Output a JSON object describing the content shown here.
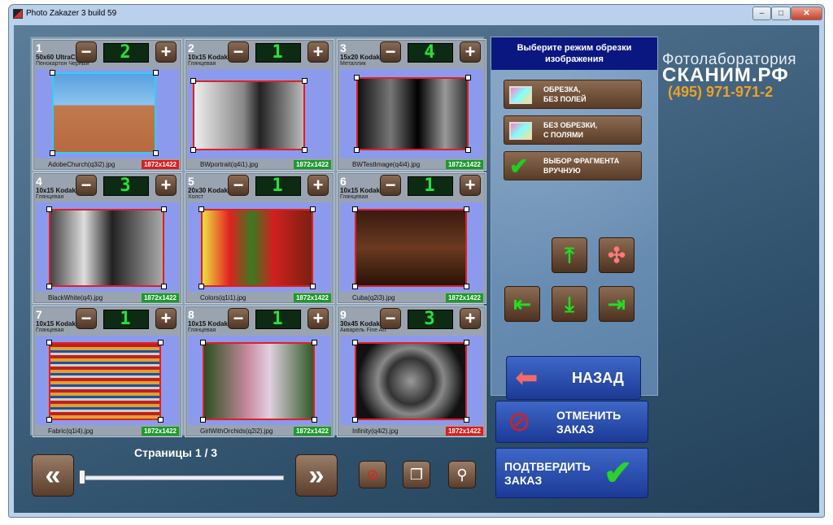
{
  "window": {
    "title": "Photo Zakazer 3 build 59",
    "min": "–",
    "max": "□",
    "close": "✕"
  },
  "photos": [
    {
      "num": "1",
      "size": "50x60 UltraChrome",
      "paper": "Пенокартон Черный",
      "qty": "2",
      "file": "AdobeChurch(q3i2).jpg",
      "res": "1872x1422",
      "res_ok": false
    },
    {
      "num": "2",
      "size": "10x15 Kodak",
      "paper": "Глянцевая",
      "qty": "1",
      "file": "BWportrait(q4i1).jpg",
      "res": "1872x1422",
      "res_ok": true
    },
    {
      "num": "3",
      "size": "15x20 Kodak",
      "paper": "Металлик",
      "qty": "4",
      "file": "BWTestImage(q4i4).jpg",
      "res": "1872x1422",
      "res_ok": true
    },
    {
      "num": "4",
      "size": "10x15 Kodak",
      "paper": "Глянцевая",
      "qty": "3",
      "file": "BlackWhite(q4).jpg",
      "res": "1872x1422",
      "res_ok": true
    },
    {
      "num": "5",
      "size": "20x30 Kodak",
      "paper": "Холст",
      "qty": "1",
      "file": "Colors(q1i1).jpg",
      "res": "1872x1422",
      "res_ok": true
    },
    {
      "num": "6",
      "size": "10x15 Kodak",
      "paper": "Глянцевая",
      "qty": "1",
      "file": "Cuba(q2i3).jpg",
      "res": "1872x1422",
      "res_ok": true
    },
    {
      "num": "7",
      "size": "10x15 Kodak",
      "paper": "Глянцевая",
      "qty": "1",
      "file": "Fabric(q1i4).jpg",
      "res": "1872x1422",
      "res_ok": true
    },
    {
      "num": "8",
      "size": "10x15 Kodak",
      "paper": "Глянцевая",
      "qty": "1",
      "file": "GirlWithOrchids(q2i2).jpg",
      "res": "1872x1422",
      "res_ok": true
    },
    {
      "num": "9",
      "size": "30x45 Kodak",
      "paper": "Акварель Fine Art",
      "qty": "3",
      "file": "Infinity(q4i2).jpg",
      "res": "1872x1422",
      "res_ok": false
    }
  ],
  "stepper": {
    "minus": "−",
    "plus": "+"
  },
  "pager": {
    "label": "Страницы 1 / 3",
    "prev": "«",
    "next": "»"
  },
  "crop": {
    "header": "Выберите режим обрезки изображения",
    "modes": [
      "ОБРЕЗКА,\nБЕЗ ПОЛЕЙ",
      "БЕЗ ОБРЕЗКИ,\nС ПОЛЯМИ",
      "ВЫБОР ФРАГМЕНТА\nВРУЧНУЮ"
    ],
    "back": "НАЗАД"
  },
  "actions": {
    "cancel": "ОТМЕНИТЬ\nЗАКАЗ",
    "confirm": "ПОДТВЕРДИТЬ\nЗАКАЗ"
  },
  "logo": {
    "line1": "Фотолаборатория",
    "line2": "СКАНИМ.РФ",
    "phone": "(495) 971-971-2"
  },
  "colors": {
    "accent_blue": "#1c3a96",
    "lcd_green": "#26e23a",
    "res_bad": "#e01c1c",
    "res_ok": "#1d9a2a"
  }
}
